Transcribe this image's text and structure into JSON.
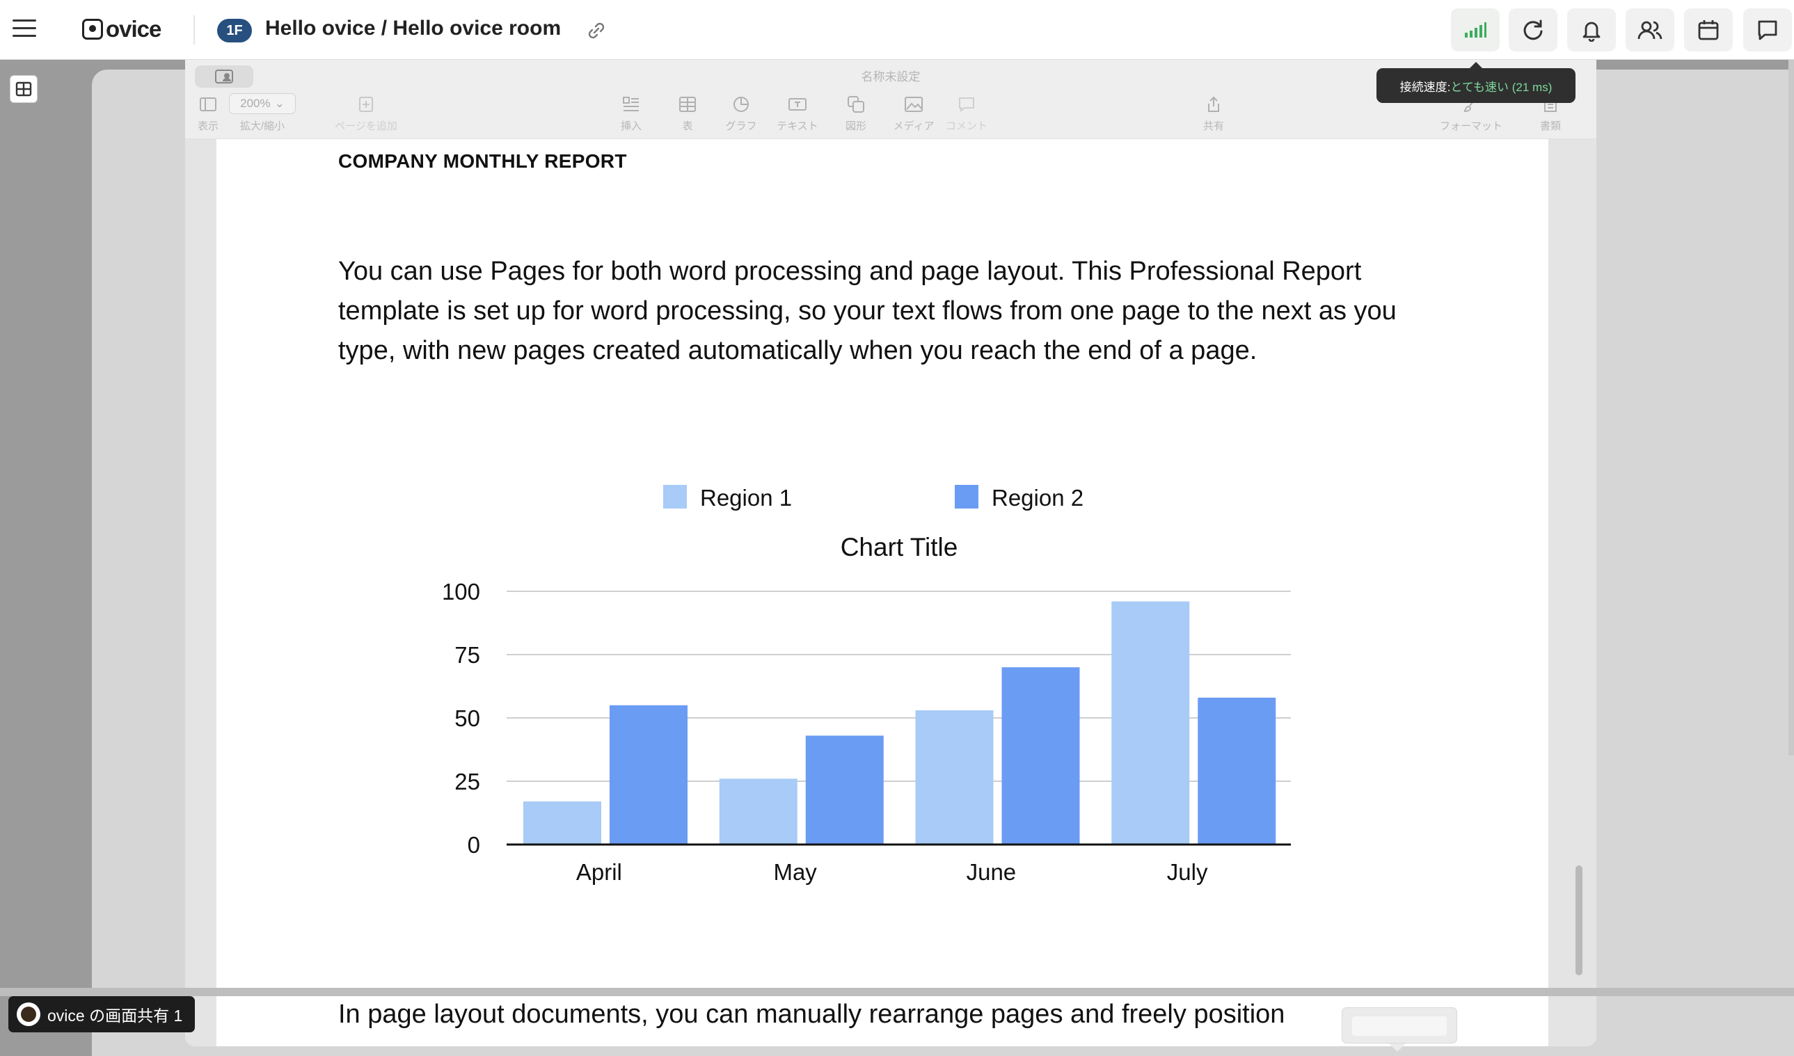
{
  "app": {
    "logo_text": "ovice"
  },
  "header": {
    "floor_badge": "1F",
    "room_title": "Hello ovice / Hello ovice room",
    "icons": [
      "menu-icon",
      "link-icon",
      "signal-icon",
      "refresh-icon",
      "bell-icon",
      "users-icon",
      "calendar-icon",
      "chat-icon"
    ]
  },
  "tooltip": {
    "prefix": "接続速度: ",
    "status": "とても速い (21 ms)"
  },
  "shared_app": {
    "document_name": "名称未設定",
    "zoom_value": "200%",
    "tools": {
      "view": "表示",
      "zoom": "拡大/縮小",
      "add_page": "ページを追加",
      "insert": "挿入",
      "table": "表",
      "chart": "グラフ",
      "text": "テキスト",
      "shape": "図形",
      "media": "メディア",
      "comment": "コメント",
      "share": "共有",
      "format": "フォーマット",
      "document": "書類"
    }
  },
  "document": {
    "title": "COMPANY MONTHLY REPORT",
    "paragraph": "You can use Pages for both word processing and page layout. This Professional Report template is set up for word processing, so your text flows from one page to the next as you type, with new pages created automatically when you reach the end of a page.",
    "paragraph2": "In page layout documents, you can manually rearrange pages and freely position"
  },
  "chart_data": {
    "type": "bar",
    "title": "Chart Title",
    "categories": [
      "April",
      "May",
      "June",
      "July"
    ],
    "series": [
      {
        "name": "Region 1",
        "values": [
          17,
          26,
          53,
          96
        ],
        "color": "#a8cbf7"
      },
      {
        "name": "Region 2",
        "values": [
          55,
          43,
          70,
          58
        ],
        "color": "#6b9cf4"
      }
    ],
    "y_ticks": [
      0,
      25,
      50,
      75,
      100
    ],
    "ylim": [
      0,
      100
    ],
    "grid": true,
    "legend": "top"
  },
  "share_badge": {
    "label": "ovice の画面共有 1"
  }
}
